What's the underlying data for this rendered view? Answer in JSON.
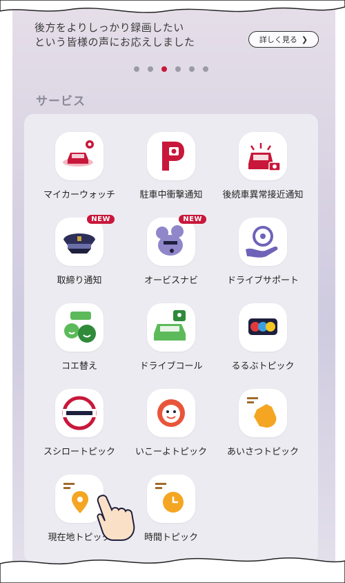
{
  "banner": {
    "line1": "後方をよりしっかり録画したい",
    "line2": "という皆様の声にお応えしました",
    "detail_button": "詳しく見る",
    "carousel_total": 6,
    "carousel_active": 3
  },
  "section_title": "サービス",
  "services": [
    {
      "label": "マイカーウォッチ",
      "icon": "car-watch-icon"
    },
    {
      "label": "駐車中衝撃通知",
      "icon": "parking-shock-icon"
    },
    {
      "label": "後続車異常接近通知",
      "icon": "rear-approach-icon"
    },
    {
      "label": "取締り通知",
      "icon": "police-cap-icon",
      "badge": "NEW"
    },
    {
      "label": "オービスナビ",
      "icon": "mouse-orbis-icon",
      "badge": "NEW"
    },
    {
      "label": "ドライブサポート",
      "icon": "steering-hand-icon"
    },
    {
      "label": "コエ替え",
      "icon": "voice-change-icon"
    },
    {
      "label": "ドライブコール",
      "icon": "drive-call-icon"
    },
    {
      "label": "るるぶトピック",
      "icon": "rurubu-icon"
    },
    {
      "label": "スシロートピック",
      "icon": "sushiro-icon"
    },
    {
      "label": "いこーよトピック",
      "icon": "iko-yo-icon"
    },
    {
      "label": "あいさつトピック",
      "icon": "waving-hand-icon"
    },
    {
      "label": "現在地トピック",
      "icon": "location-pin-icon"
    },
    {
      "label": "時間トピック",
      "icon": "clock-icon"
    }
  ],
  "colors": {
    "accent_red": "#c8173a",
    "orange": "#f4a622",
    "green": "#5cba5a"
  }
}
